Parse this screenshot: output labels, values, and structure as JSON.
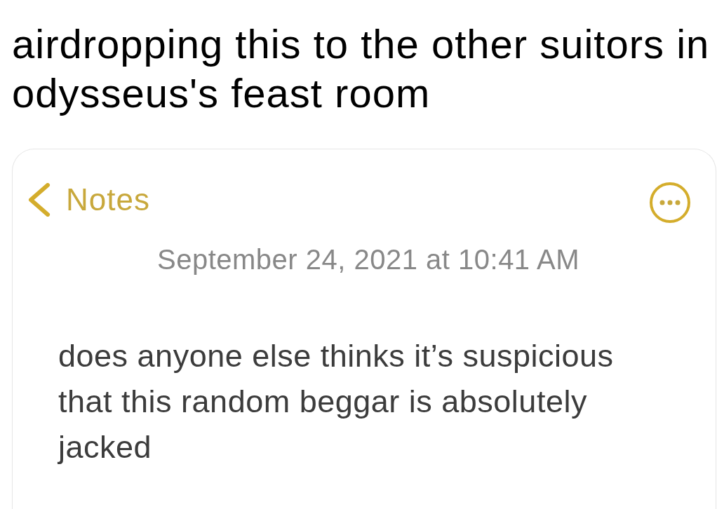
{
  "post": {
    "text": "airdropping this to the other suitors in odysseus's feast room"
  },
  "note": {
    "back_label": "Notes",
    "timestamp": "September 24, 2021 at 10:41 AM",
    "body": "does anyone else thinks it’s suspicious that this random beggar is absolutely jacked"
  }
}
